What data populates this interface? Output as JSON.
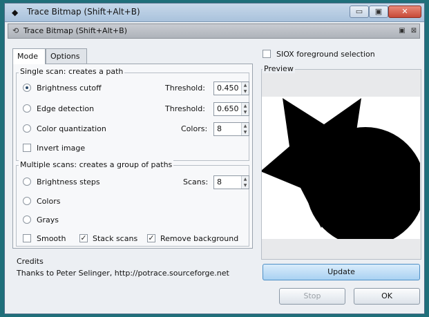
{
  "window": {
    "title": "Trace Bitmap (Shift+Alt+B)",
    "min_glyph": "▭",
    "max_glyph": "▣",
    "close_glyph": "✕"
  },
  "dock": {
    "title": "Trace Bitmap (Shift+Alt+B)",
    "btn1": "▣",
    "btn2": "⊠"
  },
  "tabs": {
    "mode": "Mode",
    "options": "Options"
  },
  "single_scan": {
    "title": "Single scan: creates a path",
    "brightness_cutoff": {
      "label": "Brightness cutoff",
      "param_label": "Threshold:",
      "value": "0.450",
      "selected": true
    },
    "edge_detection": {
      "label": "Edge detection",
      "param_label": "Threshold:",
      "value": "0.650",
      "selected": false
    },
    "color_quantization": {
      "label": "Color quantization",
      "param_label": "Colors:",
      "value": "8",
      "selected": false
    },
    "invert_image": {
      "label": "Invert image",
      "checked": false
    }
  },
  "multiple_scans": {
    "title": "Multiple scans: creates a group of paths",
    "brightness_steps": {
      "label": "Brightness steps",
      "param_label": "Scans:",
      "value": "8",
      "selected": false
    },
    "colors": {
      "label": "Colors",
      "selected": false
    },
    "grays": {
      "label": "Grays",
      "selected": false
    },
    "smooth": {
      "label": "Smooth",
      "checked": false
    },
    "stack_scans": {
      "label": "Stack scans",
      "checked": true
    },
    "remove_background": {
      "label": "Remove background",
      "checked": true
    }
  },
  "credits": {
    "title": "Credits",
    "text": "Thanks to Peter Selinger, http://potrace.sourceforge.net"
  },
  "siox": {
    "label": "SIOX foreground selection",
    "checked": false
  },
  "preview": {
    "label": "Preview"
  },
  "buttons": {
    "update": "Update",
    "stop": "Stop",
    "ok": "OK"
  },
  "colors": {
    "accent": "#a9d1f2",
    "window_bg": "#eceff3",
    "desktop": "#1f6f7a"
  }
}
